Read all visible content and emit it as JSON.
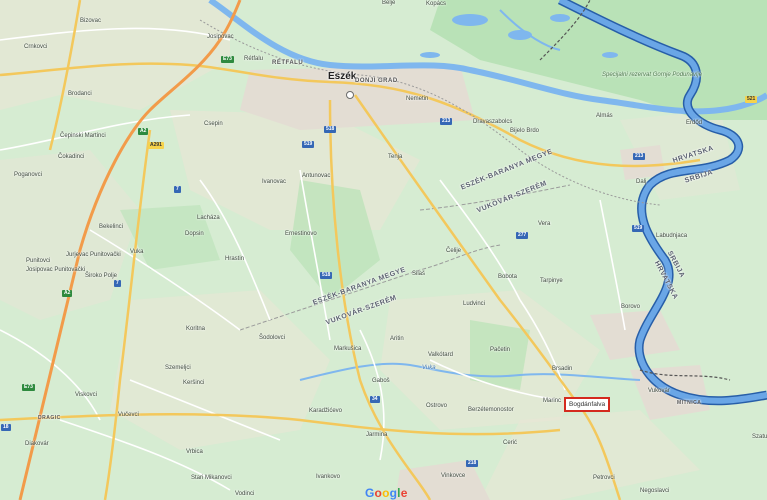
{
  "colors": {
    "land": "#d6ecd2",
    "forest": "#b9e2b7",
    "urban": "#e8e2d6",
    "farmland": "#ece5d6",
    "water": "#6aa6e6",
    "river_outline": "#275ea8",
    "road_major": "#f3c85c",
    "road_minor": "#ffffff",
    "rail": "#9a9a9a",
    "highlight_border": "#d42a1e"
  },
  "icons": [
    "location-pin-icon"
  ],
  "places": {
    "cities": [
      "Eszék"
    ],
    "districts": [
      "RÉTFALU",
      "DONJI GRAD",
      "DRAGIC",
      "MITNICA"
    ],
    "regions": [
      "ESZÉK-BARANYA MEGYE",
      "VUKOVÁR-SZERÉM",
      "ESZÉK-BARANYA MEGYE",
      "VUKOVÁR-SZERÉM",
      "HRVATSKA",
      "SRBIJA",
      "SRBIJA",
      "HRVATSKA"
    ],
    "villages": [
      "Bizovac",
      "Belje",
      "Kopács",
      "Josipovac",
      "Crnkovci",
      "Rétfalu",
      "Nemetin",
      "Brodanci",
      "Csepin",
      "Dravaszabolcs",
      "Bijelo Brdo",
      "Almás",
      "Erdőd",
      "Čepinski Martinci",
      "Čokadinci",
      "Tenja",
      "Ivanovac",
      "Antunovac",
      "Dalj",
      "Poganovci",
      "Lacháza",
      "Dopsin",
      "Ernestinovo",
      "Labudnjaca",
      "Bekelinci",
      "Jurjevac Punitovački",
      "Vuka",
      "Hrastin",
      "Vera",
      "Čelije",
      "Punitovci",
      "Josipovac Punitovački",
      "Bobota",
      "Silaš",
      "Tarpinye",
      "Široko Polje",
      "Ludvinci",
      "Borovo",
      "Koritna",
      "Šodolovci",
      "Aritin",
      "Markušica",
      "Valkótard",
      "Pačetin",
      "Szemeljci",
      "Brsadin",
      "Keršinci",
      "Gaboš",
      "Vukovár",
      "Viskovci",
      "Ostrovo",
      "Berzétemonostor",
      "Marinc",
      "Vučevci",
      "Karadžićevo",
      "Diakovár",
      "Jarmina",
      "Cerić",
      "Vrbica",
      "Stari Mikanovci",
      "Ivankovo",
      "Vodinci",
      "Vinkovce",
      "Petrovci",
      "Negoslavci",
      "Szatu"
    ],
    "nature": [
      "Specijalni rezervat Gornje Podunavlje",
      "Vuka"
    ]
  },
  "roads": [
    "E73",
    "A2",
    "4",
    "7",
    "17",
    "18",
    "34",
    "57",
    "213",
    "218",
    "277",
    "518",
    "519",
    "521",
    "A291"
  ],
  "highlighted_place": "Bogdánfalva",
  "attribution": {
    "provider": "Google",
    "letters": [
      "G",
      "o",
      "o",
      "g",
      "l",
      "e"
    ]
  }
}
